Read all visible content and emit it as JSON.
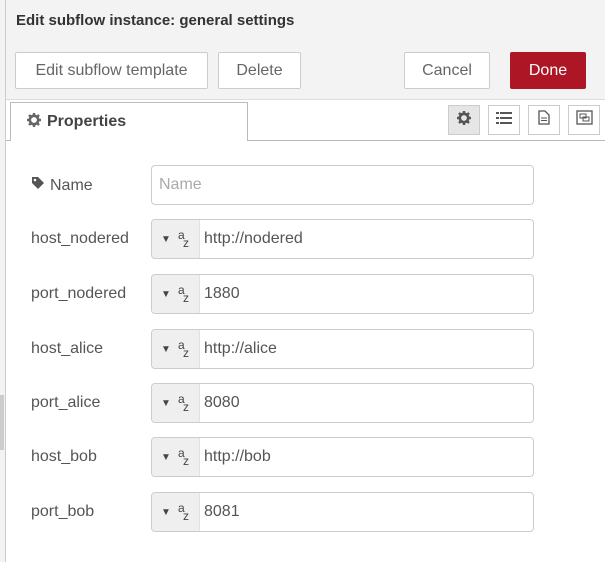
{
  "header": {
    "title": "Edit subflow instance: general settings"
  },
  "toolbar": {
    "edit_template_label": "Edit subflow template",
    "delete_label": "Delete",
    "cancel_label": "Cancel",
    "done_label": "Done",
    "done_color": "#ad1625"
  },
  "tabs": {
    "properties_label": "Properties"
  },
  "form": {
    "name": {
      "label": "Name",
      "placeholder": "Name",
      "value": ""
    },
    "fields": [
      {
        "label": "host_nodered",
        "value": "http://nodered",
        "type": "string"
      },
      {
        "label": "port_nodered",
        "value": "1880",
        "type": "string"
      },
      {
        "label": "host_alice",
        "value": "http://alice",
        "type": "string"
      },
      {
        "label": "port_alice",
        "value": "8080",
        "type": "string"
      },
      {
        "label": "host_bob",
        "value": "http://bob",
        "type": "string"
      },
      {
        "label": "port_bob",
        "value": "8081",
        "type": "string"
      }
    ]
  }
}
